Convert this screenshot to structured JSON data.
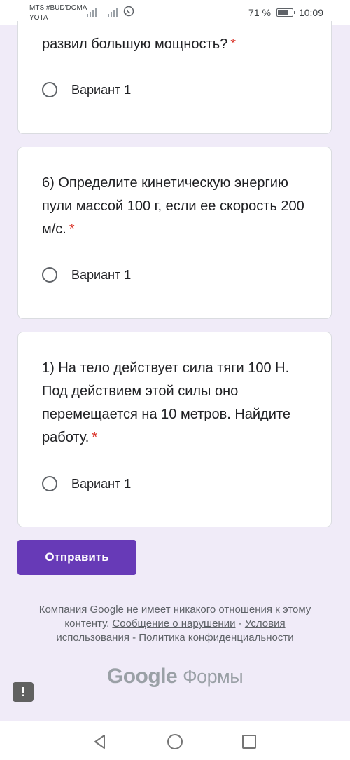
{
  "status_bar": {
    "carrier_line1": "MTS #BUD'DOMA",
    "carrier_line2": "YOTA",
    "battery_percent": "71 %",
    "time": "10:09"
  },
  "questions": [
    {
      "text": "развил большую мощность?",
      "required": "*",
      "option": "Вариант 1"
    },
    {
      "text": "6) Определите кинетическую энергию пули массой 100 г, если ее скорость 200 м/с.",
      "required": "*",
      "option": "Вариант 1"
    },
    {
      "text": "1) На тело действует сила тяги 100 Н. Под действием этой силы оно перемещается на 10 метров. Найдите работу.",
      "required": "*",
      "option": "Вариант 1"
    }
  ],
  "submit_label": "Отправить",
  "footer": {
    "disclaimer": "Компания Google не имеет никакого отношения к этому контенту.",
    "report_link": "Сообщение о нарушении",
    "separator": "-",
    "terms_link": "Условия использования",
    "privacy_link": "Политика конфиденциальности"
  },
  "brand": {
    "google": "Google",
    "forms": "Формы"
  },
  "report_icon": "!",
  "icons": {
    "whatsapp": "whatsapp-icon",
    "battery": "battery-icon",
    "back": "back-triangle-icon",
    "home": "home-circle-icon",
    "recents": "recents-square-icon",
    "report": "report-problem-icon"
  },
  "colors": {
    "background": "#f0ebf8",
    "accent": "#673ab7",
    "required": "#d93025"
  }
}
